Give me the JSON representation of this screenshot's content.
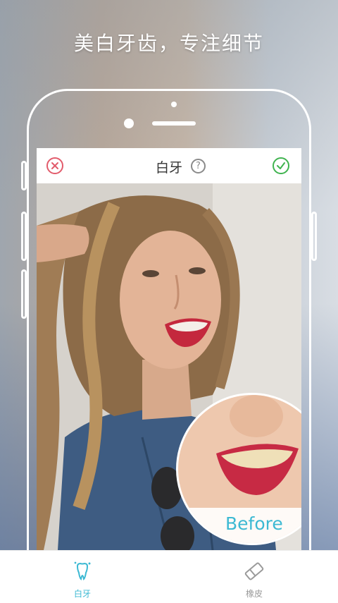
{
  "headline": "美白牙齿，专注细节",
  "editor": {
    "title": "白牙",
    "help_icon": "question-circle-icon",
    "cancel_icon": "close-circle-icon",
    "confirm_icon": "check-circle-icon",
    "magnifier_label": "Before"
  },
  "tabs": [
    {
      "label": "白牙",
      "icon": "tooth-sparkle-icon",
      "active": true
    },
    {
      "label": "橡皮",
      "icon": "eraser-icon",
      "active": false
    }
  ],
  "colors": {
    "accent": "#3cb9d3",
    "cancel": "#e25b6b",
    "confirm": "#3fb34f",
    "inactive_tab": "#9a9a9a"
  }
}
